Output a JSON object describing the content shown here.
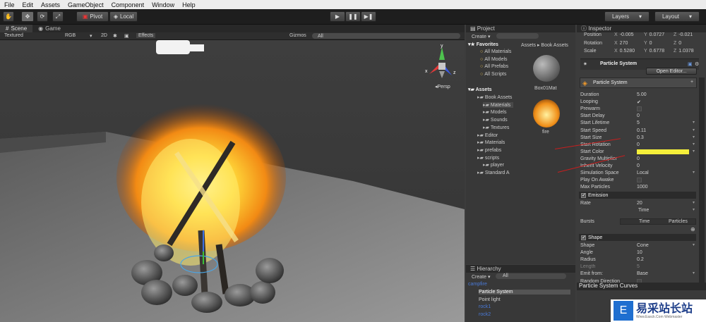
{
  "menu": [
    "File",
    "Edit",
    "Assets",
    "GameObject",
    "Component",
    "Window",
    "Help"
  ],
  "toolbar": {
    "pivot": "Pivot",
    "local": "Local",
    "layers": "Layers",
    "layout": "Layout"
  },
  "scene_tabs": {
    "scene": "Scene",
    "game": "Game"
  },
  "scene_bar": {
    "shading": "Textured",
    "mode": "RGB",
    "twod": "2D",
    "effects": "Effects",
    "gizmos": "Gizmos",
    "search": "All"
  },
  "scene_view": {
    "persp": "Persp"
  },
  "project": {
    "title": "Project",
    "create": "Create",
    "favorites_title": "Favorites",
    "favorites": [
      "All Materials",
      "All Models",
      "All Prefabs",
      "All Scripts"
    ],
    "assets_title": "Assets",
    "tree": [
      {
        "label": "Book Assets",
        "indent": 1
      },
      {
        "label": "Materials",
        "indent": 2
      },
      {
        "label": "Models",
        "indent": 2
      },
      {
        "label": "Sounds",
        "indent": 2
      },
      {
        "label": "Textures",
        "indent": 2
      },
      {
        "label": "Editor",
        "indent": 1
      },
      {
        "label": "Materials",
        "indent": 1
      },
      {
        "label": "prefabs",
        "indent": 1
      },
      {
        "label": "scripts",
        "indent": 1
      },
      {
        "label": "player",
        "indent": 2
      },
      {
        "label": "Standard A",
        "indent": 1
      }
    ],
    "breadcrumb": "Assets ▸ Book Assets",
    "items": [
      {
        "label": "Box01Mat"
      },
      {
        "label": "fire"
      }
    ]
  },
  "hierarchy": {
    "title": "Hierarchy",
    "create": "Create",
    "search": "All",
    "items": [
      "campfire",
      "Particle System",
      "Point light",
      "rock1",
      "rock2"
    ]
  },
  "inspector": {
    "title": "Inspector",
    "transform": [
      {
        "label": "Position",
        "x": "-0.005",
        "y": "0.0727",
        "z": "-0.021"
      },
      {
        "label": "Rotation",
        "x": "270",
        "y": "0",
        "z": "0"
      },
      {
        "label": "Scale",
        "x": "0.5280",
        "y": "0.6778",
        "z": "1.0378"
      }
    ],
    "component": "Particle System",
    "open_editor": "Open Editor...",
    "module": "Particle System",
    "props": [
      {
        "k": "Duration",
        "v": "5.00"
      },
      {
        "k": "Looping",
        "v": "✔"
      },
      {
        "k": "Prewarm",
        "v": ""
      },
      {
        "k": "Start Delay",
        "v": "0"
      },
      {
        "k": "Start Lifetime",
        "v": "5"
      },
      {
        "k": "Start Speed",
        "v": "0.11"
      },
      {
        "k": "Start Size",
        "v": "0.3"
      },
      {
        "k": "Start Rotation",
        "v": "0"
      },
      {
        "k": "Start Color",
        "v": ""
      },
      {
        "k": "Gravity Multiplier",
        "v": "0"
      },
      {
        "k": "Inherit Velocity",
        "v": "0"
      },
      {
        "k": "Simulation Space",
        "v": "Local"
      },
      {
        "k": "Play On Awake",
        "v": ""
      },
      {
        "k": "Max Particles",
        "v": "1000"
      }
    ],
    "emission_title": "Emission",
    "emission": [
      {
        "k": "Rate",
        "v": "20"
      },
      {
        "k": "",
        "v": "Time"
      }
    ],
    "bursts": {
      "k": "Bursts",
      "time": "Time",
      "particles": "Particles"
    },
    "shape_title": "Shape",
    "shape": [
      {
        "k": "Shape",
        "v": "Cone"
      },
      {
        "k": "Angle",
        "v": "10"
      },
      {
        "k": "Radius",
        "v": "0.2"
      },
      {
        "k": "Length",
        "v": "5"
      },
      {
        "k": "Emit from:",
        "v": "Base"
      },
      {
        "k": "Random Direction",
        "v": ""
      }
    ],
    "curves": "Particle System Curves"
  },
  "colors": {
    "start_color": "#f5ef3a",
    "accent": "#4a7ad8"
  },
  "watermark": {
    "text": "易采站长站",
    "sub": "Www.Easck.Com Webmaster"
  }
}
